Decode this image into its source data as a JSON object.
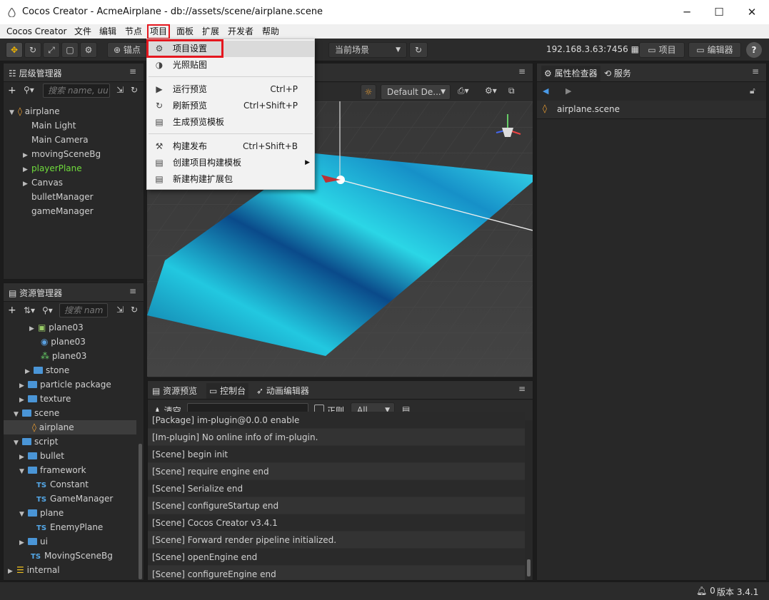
{
  "window": {
    "title": "Cocos Creator - AcmeAirplane - db://assets/scene/airplane.scene",
    "minimize": "─",
    "maximize": "☐",
    "close": "✕"
  },
  "menubar": [
    "Cocos Creator",
    "文件",
    "编辑",
    "节点",
    "项目",
    "面板",
    "扩展",
    "开发者",
    "帮助"
  ],
  "toolbar": {
    "pivot_label": "锚点",
    "scene_select": "当前场景",
    "ip_address": "192.168.3.63:7456",
    "project_button": "项目",
    "editor_button": "编辑器",
    "help": "?"
  },
  "dropdown": {
    "items": [
      {
        "label": "项目设置",
        "shortcut": "",
        "icon": "gear-icon"
      },
      {
        "label": "光照贴图",
        "shortcut": "",
        "icon": "lightmap-icon"
      },
      {
        "label": "运行预览",
        "shortcut": "Ctrl+P",
        "icon": "play-icon"
      },
      {
        "label": "刷新预览",
        "shortcut": "Ctrl+Shift+P",
        "icon": "refresh-icon"
      },
      {
        "label": "生成预览模板",
        "shortcut": "",
        "icon": "document-icon"
      },
      {
        "label": "构建发布",
        "shortcut": "Ctrl+Shift+B",
        "icon": "build-icon"
      },
      {
        "label": "创建项目构建模板",
        "shortcut": "",
        "icon": "document-icon"
      },
      {
        "label": "新建构建扩展包",
        "shortcut": "",
        "icon": "document-icon"
      }
    ]
  },
  "hierarchy": {
    "title": "层级管理器",
    "search_placeholder": "搜索 name, uu",
    "nodes": [
      {
        "label": "airplane",
        "depth": 0,
        "arrow": "down",
        "icon": "scene"
      },
      {
        "label": "Main Light",
        "depth": 1,
        "arrow": ""
      },
      {
        "label": "Main Camera",
        "depth": 1,
        "arrow": ""
      },
      {
        "label": "movingSceneBg",
        "depth": 1,
        "arrow": "right"
      },
      {
        "label": "playerPlane",
        "depth": 1,
        "arrow": "right",
        "highlight": true
      },
      {
        "label": "Canvas",
        "depth": 1,
        "arrow": "right"
      },
      {
        "label": "bulletManager",
        "depth": 1,
        "arrow": ""
      },
      {
        "label": "gameManager",
        "depth": 1,
        "arrow": ""
      }
    ]
  },
  "assets": {
    "title": "资源管理器",
    "search_placeholder": "搜索 nam",
    "nodes": [
      {
        "label": "plane03",
        "depth": 2,
        "arrow": "right",
        "icon": "mesh"
      },
      {
        "label": "plane03",
        "depth": 2,
        "arrow": "",
        "icon": "material"
      },
      {
        "label": "plane03",
        "depth": 2,
        "arrow": "",
        "icon": "prefab"
      },
      {
        "label": "stone",
        "depth": 1,
        "arrow": "right",
        "icon": "folder"
      },
      {
        "label": "particle package",
        "depth": 0,
        "arrow": "right",
        "icon": "folder"
      },
      {
        "label": "texture",
        "depth": 0,
        "arrow": "right",
        "icon": "folder"
      },
      {
        "label": "scene",
        "depth": 0,
        "arrow": "down",
        "icon": "folder"
      },
      {
        "label": "airplane",
        "depth": 1,
        "arrow": "",
        "icon": "scene",
        "selected": true
      },
      {
        "label": "script",
        "depth": 0,
        "arrow": "down",
        "icon": "folder"
      },
      {
        "label": "bullet",
        "depth": 1,
        "arrow": "right",
        "icon": "folder"
      },
      {
        "label": "framework",
        "depth": 1,
        "arrow": "down",
        "icon": "folder"
      },
      {
        "label": "Constant",
        "depth": 2,
        "arrow": "",
        "icon": "ts"
      },
      {
        "label": "GameManager",
        "depth": 2,
        "arrow": "",
        "icon": "ts"
      },
      {
        "label": "plane",
        "depth": 1,
        "arrow": "down",
        "icon": "folder"
      },
      {
        "label": "EnemyPlane",
        "depth": 2,
        "arrow": "",
        "icon": "ts"
      },
      {
        "label": "ui",
        "depth": 1,
        "arrow": "right",
        "icon": "folder"
      },
      {
        "label": "MovingSceneBg",
        "depth": 1,
        "arrow": "",
        "icon": "ts"
      },
      {
        "label": "internal",
        "depth": -1,
        "arrow": "right",
        "icon": "db"
      }
    ]
  },
  "scene": {
    "camera_select": "Default De..."
  },
  "inspector": {
    "tab1": "属性检查器",
    "tab2": "服务",
    "file": "airplane.scene"
  },
  "bottom": {
    "tabs": [
      "资源预览",
      "控制台",
      "动画编辑器"
    ],
    "clear": "清空",
    "regex": "正则",
    "level": "All",
    "lines": [
      "[Package] im-plugin@0.0.0 enable",
      "[Im-plugin] No online info of im-plugin.",
      "[Scene] begin init",
      "[Scene] require engine end",
      "[Scene] Serialize end",
      "[Scene] configureStartup end",
      "[Scene] Cocos Creator v3.4.1",
      "[Scene] Forward render pipeline initialized.",
      "[Scene] openEngine end",
      "[Scene] configureEngine end"
    ]
  },
  "status": {
    "count": "0",
    "version": "版本 3.4.1"
  },
  "colors": {
    "accent_red": "#e5171f",
    "node_green": "#6fdc3c",
    "folder_blue": "#4a95d6"
  }
}
